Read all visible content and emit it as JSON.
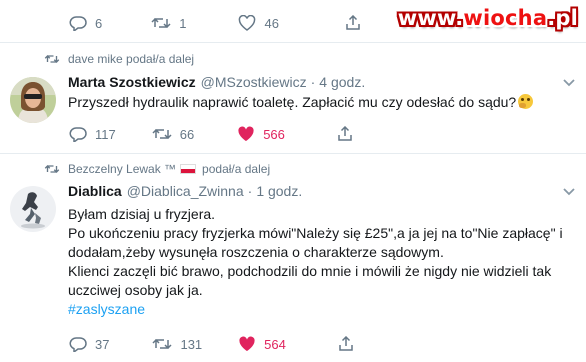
{
  "watermark": {
    "prefix": "www.",
    "brand": "wiocha",
    "suffix": ".pl"
  },
  "top_actions": {
    "replies": "6",
    "retweets": "1",
    "likes": "46"
  },
  "tweet1": {
    "retweet_context": "dave mike podał/a dalej",
    "name": "Marta Szostkiewicz",
    "handle": "@MSzostkiewicz",
    "separator": "·",
    "time": "4 godz.",
    "text": "Przyszedł hydraulik naprawić toaletę. Zapłacić mu czy odesłać do sądu?",
    "replies": "117",
    "retweets": "66",
    "likes": "566"
  },
  "tweet2": {
    "retweet_context_name": "Bezczelny Lewak ™",
    "retweet_context_action": "podał/a dalej",
    "name": "Diablica",
    "handle": "@Diablica_Zwinna",
    "separator": "·",
    "time": "1 godz.",
    "lines": [
      "Byłam dzisiaj u fryzjera.",
      "Po ukończeniu pracy fryzjerka mówi\"Należy się £25\",a ja jej na to\"Nie zapłacę\" i",
      "dodałam,żeby wysunęła roszczenia o charakterze sądowym.",
      "Klienci zaczęli bić brawo, podchodzili do mnie i mówili że nigdy nie widzieli tak",
      "uczciwej osoby jak ja."
    ],
    "hashtag": "#zaslyszane",
    "replies": "37",
    "retweets": "131",
    "likes": "564"
  },
  "colors": {
    "accent": "#1da1f2",
    "like": "#e0245e",
    "muted": "#657786",
    "text": "#14171a",
    "divider": "#e6ecf0"
  }
}
